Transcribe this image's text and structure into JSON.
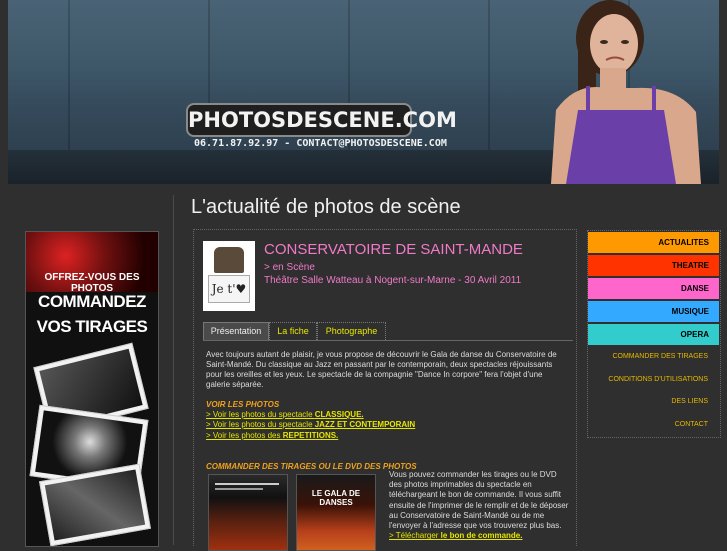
{
  "header": {
    "logo": "PHOTOSDESCENE.COM",
    "contact": "06.71.87.92.97 - CONTACT@PHOTOSDESCENE.COM"
  },
  "banner": {
    "line1": "OFFREZ-VOUS DES PHOTOS",
    "line2": "COMMANDEZ",
    "line3": "VOS TIRAGES"
  },
  "page_title": "L'actualité de photos de scène",
  "article": {
    "thumb_sign": "Je t'♥",
    "title": "CONSERVATOIRE DE SAINT-MANDE",
    "category": "> en Scène",
    "venue": "Théâtre Salle Watteau à Nogent-sur-Marne - 30 Avril 2011",
    "tabs": [
      "Présentation",
      "La fiche",
      "Photographe"
    ],
    "intro": "Avec toujours autant de plaisir, je vous propose de découvrir le Gala de danse du Conservatoire de Saint-Mandé. Du classique au Jazz en passant par le contemporain, deux spectacles réjouissants pour les oreilles et les yeux. Le spectacle de la compagnie \"Dance In corpore\" fera l'objet d'une galerie séparée.",
    "photos_heading": "VOIR LES PHOTOS",
    "links": [
      {
        "prefix": "> Voir les photos du spectacle ",
        "bold": "CLASSIQUE."
      },
      {
        "prefix": "> Voir les photos du spectacle ",
        "bold": "JAZZ ET CONTEMPORAIN"
      },
      {
        "prefix": "> Voir les photos des ",
        "bold": "REPETITIONS."
      }
    ],
    "order_heading": "COMMANDER DES TIRAGES OU LE DVD DES PHOTOS",
    "dvd_title": "LE GALA DE DANSES",
    "order_text": "Vous pouvez commander les tirages ou le DVD des photos imprimables du spectacle en téléchargeant le bon de commande. Il vous suffit ensuite de l'imprimer de le remplir et de le déposer au Conservatoire de Saint-Mandé ou de me l'envoyer à l'adresse que vos trouverez plus bas.",
    "order_link_prefix": "> Télécharger ",
    "order_link_bold": "le bon de commande."
  },
  "nav": {
    "primary": [
      {
        "label": "ACTUALITES",
        "color": "#ff9900"
      },
      {
        "label": "THEATRE",
        "color": "#ff3300"
      },
      {
        "label": "DANSE",
        "color": "#ff66cc"
      },
      {
        "label": "MUSIQUE",
        "color": "#33aaff"
      },
      {
        "label": "OPERA",
        "color": "#33cccc"
      }
    ],
    "secondary": [
      "COMMANDER DES TIRAGES",
      "CONDITIONS D'UTILISATIONS",
      "DES LIENS",
      "CONTACT"
    ]
  }
}
